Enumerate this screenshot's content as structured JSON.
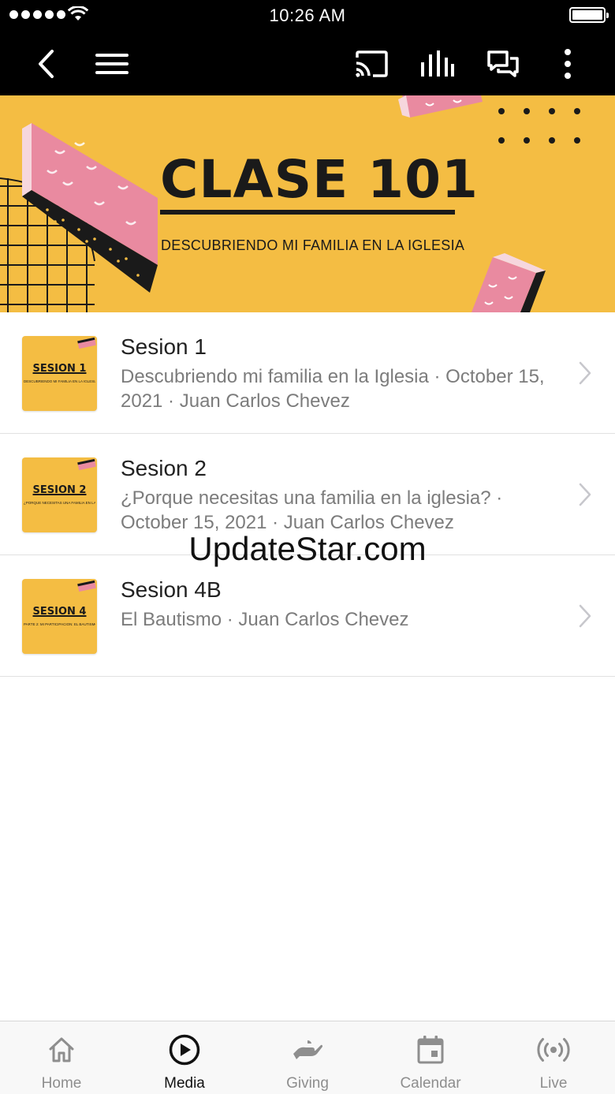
{
  "status_bar": {
    "time": "10:26 AM"
  },
  "nav": {
    "back_icon": "chevron-left-icon",
    "menu_icon": "hamburger-icon",
    "cast_icon": "cast-icon",
    "audio_icon": "equalizer-icon",
    "chat_icon": "chat-bubbles-icon",
    "more_icon": "more-vertical-icon"
  },
  "banner": {
    "title": "CLASE 101",
    "subtitle": "DESCUBRIENDO MI FAMILIA EN LA IGLESIA",
    "bg_color": "#f4bd43",
    "accent_pink": "#e98aa0"
  },
  "items": [
    {
      "thumb_title": "SESION 1",
      "thumb_sub": "DESCUBRIENDO MI FAMILIA EN LA IGLESIA",
      "title": "Sesion 1",
      "meta": "Descubriendo mi familia en la Iglesia · October 15, 2021 · Juan Carlos Chevez"
    },
    {
      "thumb_title": "SESION 2",
      "thumb_sub": "¿PORQUE NECESITAS UNA FAMILIA EN LA IGLESIA?",
      "title": "Sesion 2",
      "meta": "¿Porque necesitas una familia en la iglesia? · October 15, 2021 · Juan Carlos Chevez"
    },
    {
      "thumb_title": "SESION 4",
      "thumb_sub": "PARTE 2: MI PARTICIPACION: EL BAUTISMO",
      "title": "Sesion 4B",
      "meta": "El Bautismo · Juan Carlos Chevez"
    }
  ],
  "watermark": "UpdateStar.com",
  "tabs": [
    {
      "label": "Home",
      "icon": "home-icon",
      "active": false
    },
    {
      "label": "Media",
      "icon": "play-circle-icon",
      "active": true
    },
    {
      "label": "Giving",
      "icon": "giving-hand-icon",
      "active": false
    },
    {
      "label": "Calendar",
      "icon": "calendar-icon",
      "active": false
    },
    {
      "label": "Live",
      "icon": "broadcast-icon",
      "active": false
    }
  ]
}
